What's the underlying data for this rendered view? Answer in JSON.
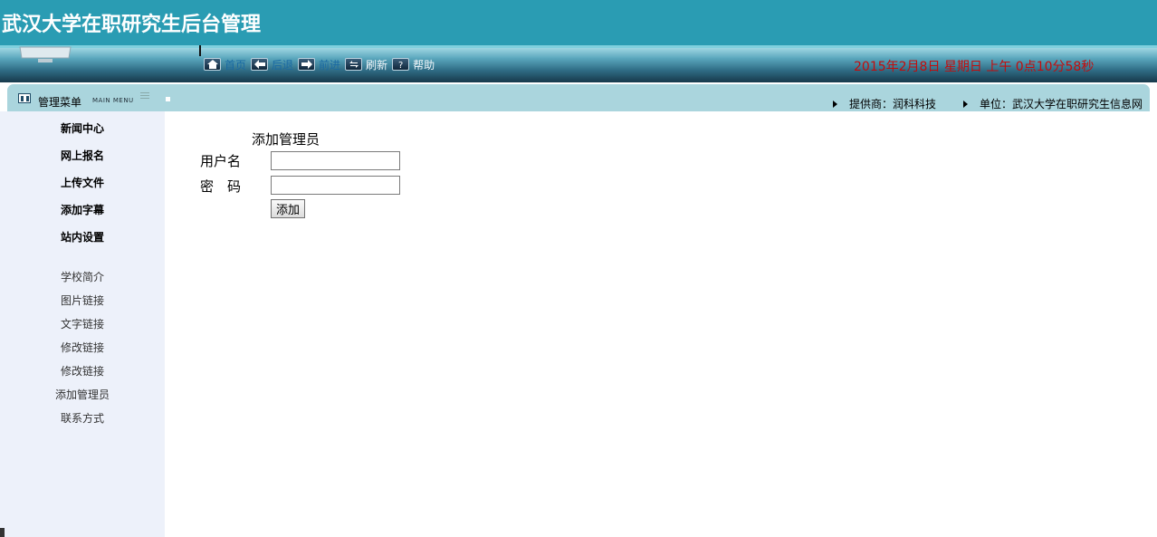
{
  "header": {
    "title": "武汉大学在职研究生后台管理",
    "datetime": "2015年2月8日 星期日 上午 0点10分58秒",
    "colors": {
      "banner": "#2a9cb3",
      "clock": "#c40c0c"
    }
  },
  "nav": {
    "home": "首页",
    "back": "后退",
    "forward": "前进",
    "refresh": "刷新",
    "help": "帮助"
  },
  "menubar": {
    "title": "管理菜单",
    "title_en": "MAIN MENU",
    "provider": "提供商：润科科技",
    "unit": "单位：武汉大学在职研究生信息网"
  },
  "sidebar": {
    "main_items": [
      {
        "label": "新闻中心"
      },
      {
        "label": "网上报名"
      },
      {
        "label": "上传文件"
      },
      {
        "label": "添加字幕"
      },
      {
        "label": "站内设置"
      }
    ],
    "sub_items": [
      {
        "label": "学校简介"
      },
      {
        "label": "图片链接"
      },
      {
        "label": "文字链接"
      },
      {
        "label": "修改链接"
      },
      {
        "label": "修改链接"
      },
      {
        "label": "添加管理员"
      },
      {
        "label": "联系方式"
      }
    ]
  },
  "form": {
    "heading": "添加管理员",
    "username_label": "用户名",
    "username_value": "",
    "password_label": "密　码",
    "password_value": "",
    "submit_label": "添加"
  }
}
